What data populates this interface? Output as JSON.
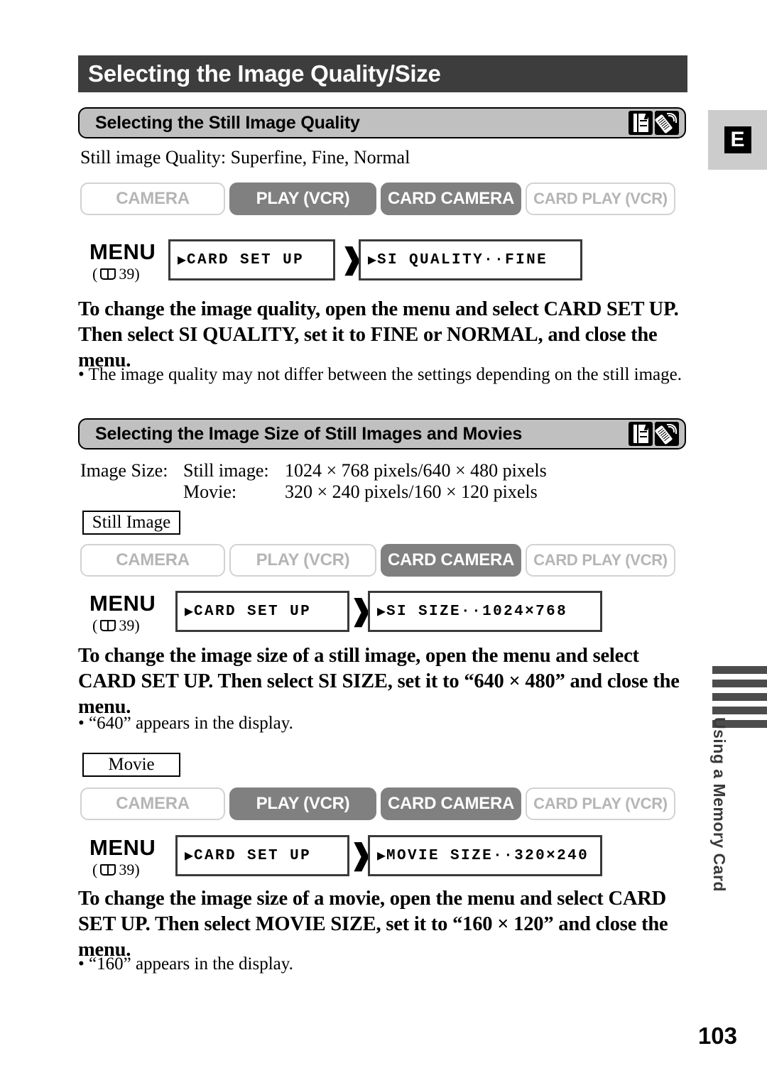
{
  "page": {
    "number": "103",
    "language_tab": "E",
    "side_index_label": "Using a Memory Card",
    "side_index_bars": 5
  },
  "title": "Selecting the Image Quality/Size",
  "sections": [
    {
      "id": "still-image-quality",
      "heading": "Selecting the Still Image Quality",
      "icons": [
        "memory-card-icon",
        "remote-control-icon"
      ],
      "intro": "Still image Quality: Superfine, Fine, Normal",
      "modes": [
        {
          "label": "CAMERA",
          "active": false
        },
        {
          "label": "PLAY (VCR)",
          "active": true
        },
        {
          "label": "CARD CAMERA",
          "active": true
        },
        {
          "label": "CARD PLAY (VCR)",
          "active": false
        }
      ],
      "menu": {
        "label": "MENU",
        "ref_open": "(",
        "ref_icon": "book-icon",
        "ref_page": "39)",
        "step1": "CARD SET UP",
        "step2": "SI QUALITY··FINE",
        "arrow": "〉"
      },
      "instruction": "To change the image quality, open the menu and select CARD SET UP.  Then select SI QUALITY, set it to FINE or NORMAL, and close the menu.",
      "bullets": [
        "• The image quality may not differ between the settings depending on the still image."
      ]
    },
    {
      "id": "image-size",
      "heading": "Selecting the Image Size of Still Images and Movies",
      "icons": [
        "memory-card-icon",
        "remote-control-icon"
      ],
      "spec_rows": [
        {
          "label": "Image Size:",
          "key": "Still image:",
          "value": "1024 × 768 pixels/640 × 480 pixels"
        },
        {
          "label": "",
          "key": "Movie:",
          "value": "320 × 240 pixels/160 × 120 pixels"
        }
      ],
      "subsections": [
        {
          "id": "still-image",
          "caption": "Still Image",
          "modes": [
            {
              "label": "CAMERA",
              "active": false
            },
            {
              "label": "PLAY (VCR)",
              "active": false
            },
            {
              "label": "CARD CAMERA",
              "active": true
            },
            {
              "label": "CARD PLAY (VCR)",
              "active": false
            }
          ],
          "menu": {
            "label": "MENU",
            "ref_open": "(",
            "ref_page": "39)",
            "step1": "CARD SET UP",
            "step2": "SI SIZE··1024×768"
          },
          "instruction": "To change the image size of a still image, open the menu and select CARD SET UP.  Then select SI SIZE, set it to “640 × 480” and close the menu.",
          "bullets": [
            "• “640” appears in the display."
          ]
        },
        {
          "id": "movie",
          "caption": "Movie",
          "modes": [
            {
              "label": "CAMERA",
              "active": false
            },
            {
              "label": "PLAY (VCR)",
              "active": true
            },
            {
              "label": "CARD CAMERA",
              "active": true
            },
            {
              "label": "CARD PLAY (VCR)",
              "active": false
            }
          ],
          "menu": {
            "label": "MENU",
            "ref_open": "(",
            "ref_page": "39)",
            "step1": "CARD SET UP",
            "step2": "MOVIE SIZE··320×240"
          },
          "instruction": "To change the image size of a movie, open the menu and select CARD SET UP.  Then select MOVIE SIZE, set it to “160 × 120” and close the menu.",
          "bullets": [
            "• “160” appears in the display."
          ]
        }
      ]
    }
  ],
  "colors": {
    "title_bar_bg": "#3d3d3d",
    "section_head_bg": "#c0c0c0",
    "mode_active_bg": "#808080",
    "mode_inactive_text": "#b5b5b5",
    "side_bar": "#4c4c4c",
    "lang_tab_bg": "#cccccc"
  }
}
